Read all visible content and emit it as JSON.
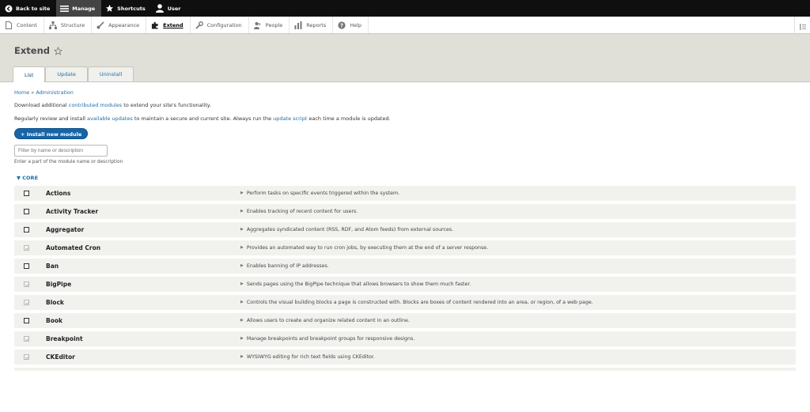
{
  "toolbar": {
    "items": [
      {
        "label": "Back to site"
      },
      {
        "label": "Manage"
      },
      {
        "label": "Shortcuts"
      },
      {
        "label": "User"
      }
    ]
  },
  "tray": {
    "items": [
      {
        "label": "Content"
      },
      {
        "label": "Structure"
      },
      {
        "label": "Appearance"
      },
      {
        "label": "Extend"
      },
      {
        "label": "Configuration"
      },
      {
        "label": "People"
      },
      {
        "label": "Reports"
      },
      {
        "label": "Help"
      }
    ]
  },
  "page": {
    "title": "Extend",
    "tabs": [
      {
        "label": "List"
      },
      {
        "label": "Update"
      },
      {
        "label": "Uninstall"
      }
    ]
  },
  "breadcrumb": {
    "home": "Home",
    "separator": "»",
    "admin": "Administration"
  },
  "help": {
    "line1_prefix": "Download additional",
    "line1_link": "contributed modules",
    "line1_suffix": "to extend your site's functionality.",
    "line2_prefix": "Regularly review and install",
    "line2_link1": "available updates",
    "line2_middle": "to maintain a secure and current site. Always run the",
    "line2_link2": "update script",
    "line2_suffix": "each time a module is updated."
  },
  "install_button": "+ Install new module",
  "filter": {
    "placeholder": "Filter by name or description",
    "description": "Enter a part of the module name or description"
  },
  "core_group": "▼ CORE",
  "modules": [
    {
      "name": "Actions",
      "desc": "Perform tasks on specific events triggered within the system."
    },
    {
      "name": "Activity Tracker",
      "desc": "Enables tracking of recent content for users."
    },
    {
      "name": "Aggregator",
      "desc": "Aggregates syndicated content (RSS, RDF, and Atom feeds) from external sources."
    },
    {
      "name": "Automated Cron",
      "desc": "Provides an automated way to run cron jobs, by executing them at the end of a server response."
    },
    {
      "name": "Ban",
      "desc": "Enables banning of IP addresses."
    },
    {
      "name": "BigPipe",
      "desc": "Sends pages using the BigPipe technique that allows browsers to show them much faster."
    },
    {
      "name": "Block",
      "desc": "Controls the visual building blocks a page is constructed with. Blocks are boxes of content rendered into an area, or region, of a web page."
    },
    {
      "name": "Book",
      "desc": "Allows users to create and organize related content in an outline."
    },
    {
      "name": "Breakpoint",
      "desc": "Manage breakpoints and breakpoint groups for responsive designs."
    },
    {
      "name": "CKEditor",
      "desc": "WYSIWYG editing for rich text fields using CKEditor."
    }
  ]
}
